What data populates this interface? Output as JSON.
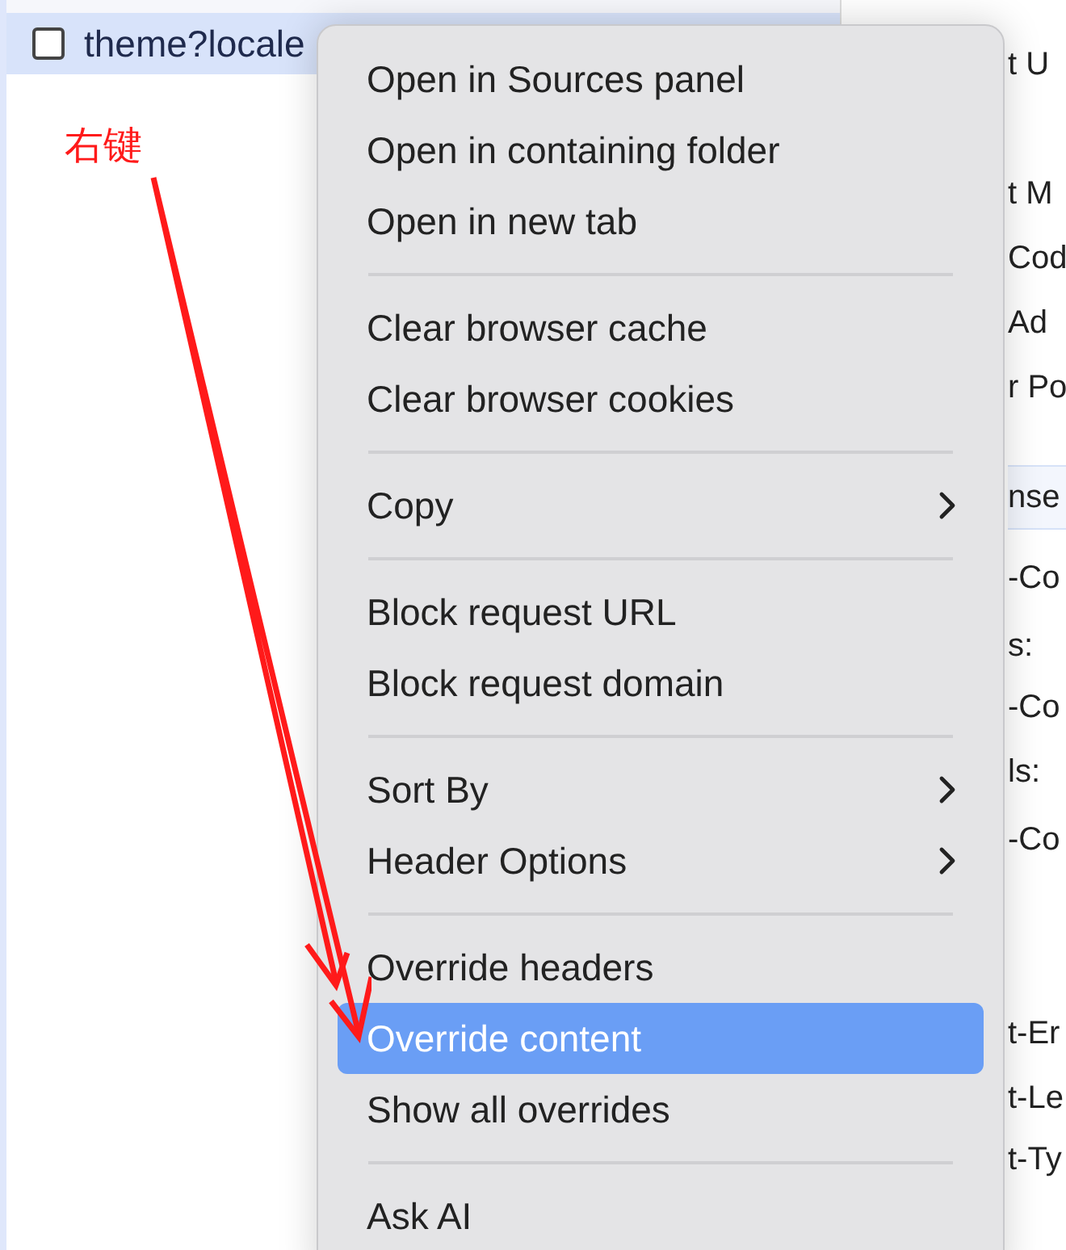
{
  "request_row": {
    "name": "theme?locale",
    "checked": false,
    "selected": true
  },
  "annotation": {
    "label": "右键"
  },
  "details_lines": [
    {
      "text": "t U",
      "kind": "line"
    },
    {
      "text": "t M",
      "kind": "line"
    },
    {
      "text": "Cod",
      "kind": "line"
    },
    {
      "text": "Ad",
      "kind": "line"
    },
    {
      "text": "r Po",
      "kind": "line"
    },
    {
      "text": "nse",
      "kind": "header"
    },
    {
      "text": "-Co",
      "kind": "line"
    },
    {
      "text": "s:",
      "kind": "line"
    },
    {
      "text": "-Co",
      "kind": "line"
    },
    {
      "text": "ls:",
      "kind": "line"
    },
    {
      "text": "-Co",
      "kind": "line"
    },
    {
      "text": "t-Er",
      "kind": "line"
    },
    {
      "text": "t-Le",
      "kind": "line"
    },
    {
      "text": "t-Ty",
      "kind": "line"
    }
  ],
  "context_menu": {
    "groups": [
      [
        {
          "label": "Open in Sources panel",
          "submenu": false,
          "selected": false
        },
        {
          "label": "Open in containing folder",
          "submenu": false,
          "selected": false
        },
        {
          "label": "Open in new tab",
          "submenu": false,
          "selected": false
        }
      ],
      [
        {
          "label": "Clear browser cache",
          "submenu": false,
          "selected": false
        },
        {
          "label": "Clear browser cookies",
          "submenu": false,
          "selected": false
        }
      ],
      [
        {
          "label": "Copy",
          "submenu": true,
          "selected": false
        }
      ],
      [
        {
          "label": "Block request URL",
          "submenu": false,
          "selected": false
        },
        {
          "label": "Block request domain",
          "submenu": false,
          "selected": false
        }
      ],
      [
        {
          "label": "Sort By",
          "submenu": true,
          "selected": false
        },
        {
          "label": "Header Options",
          "submenu": true,
          "selected": false
        }
      ],
      [
        {
          "label": "Override headers",
          "submenu": false,
          "selected": false
        },
        {
          "label": "Override content",
          "submenu": false,
          "selected": true
        },
        {
          "label": "Show all overrides",
          "submenu": false,
          "selected": false
        }
      ],
      [
        {
          "label": "Ask AI",
          "submenu": false,
          "selected": false
        }
      ]
    ]
  }
}
